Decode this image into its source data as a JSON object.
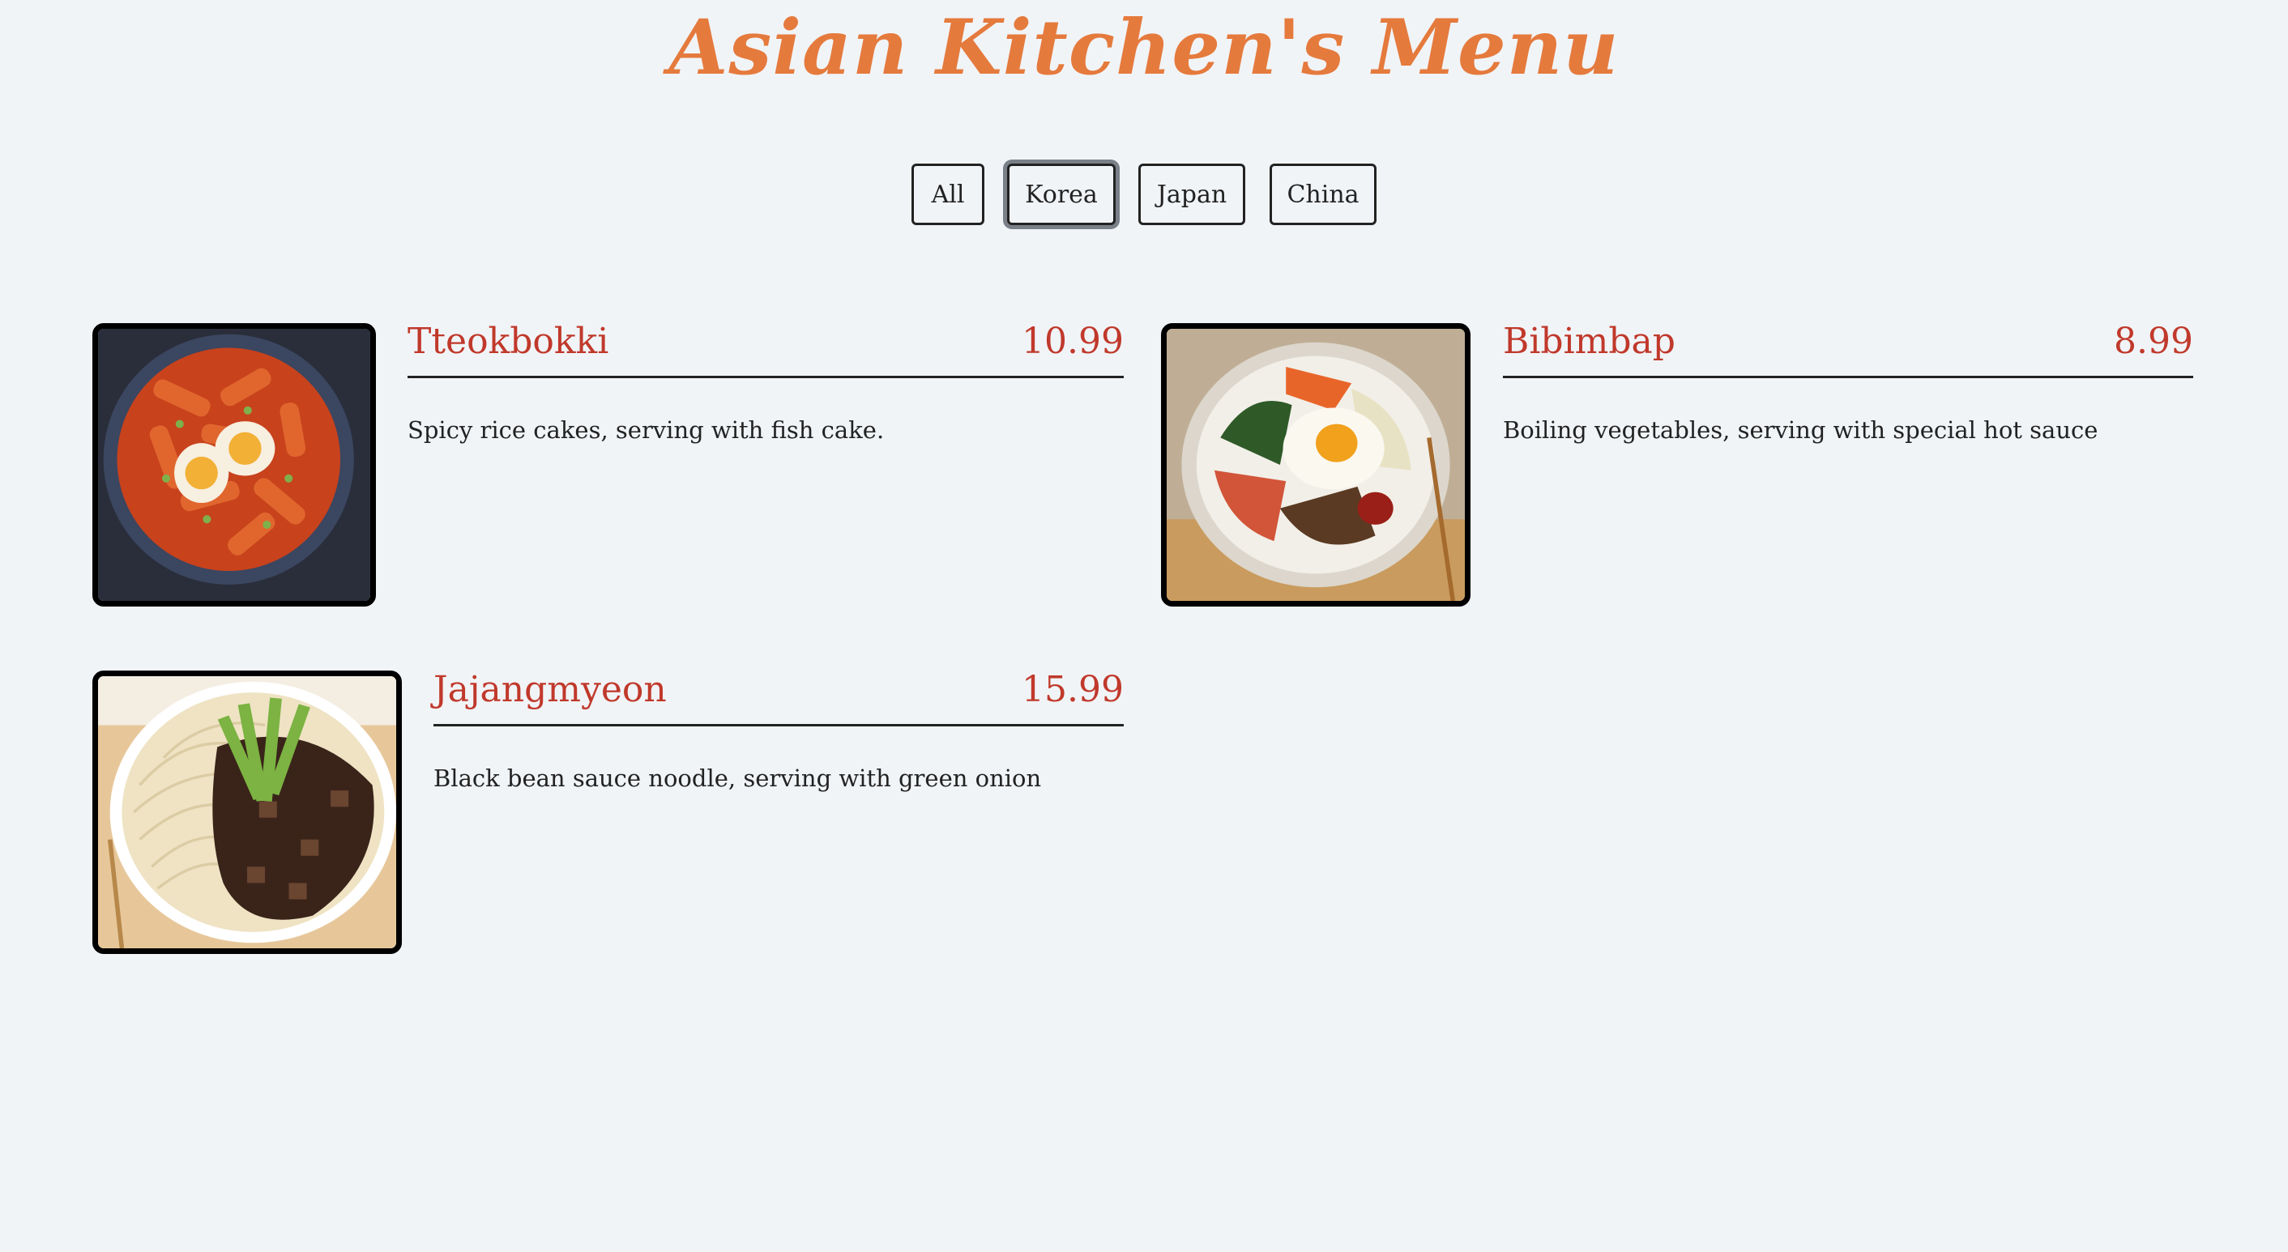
{
  "header": {
    "title": "Asian Kitchen's Menu"
  },
  "filters": {
    "items": [
      {
        "label": "All"
      },
      {
        "label": "Korea"
      },
      {
        "label": "Japan"
      },
      {
        "label": "China"
      }
    ],
    "active": "Korea"
  },
  "menu": {
    "items": [
      {
        "name": "Tteokbokki",
        "price": "10.99",
        "description": "Spicy rice cakes, serving with fish cake.",
        "image_icon": "tteokbokki-photo"
      },
      {
        "name": "Bibimbap",
        "price": "8.99",
        "description": "Boiling vegetables, serving with special hot sauce",
        "image_icon": "bibimbap-photo"
      },
      {
        "name": "Jajangmyeon",
        "price": "15.99",
        "description": "Black bean sauce noodle, serving with green onion",
        "image_icon": "jajangmyeon-photo"
      }
    ]
  },
  "colors": {
    "background": "#f1f4f7",
    "title": "#e57a3d",
    "accent": "#c0392b",
    "text": "#222222"
  }
}
